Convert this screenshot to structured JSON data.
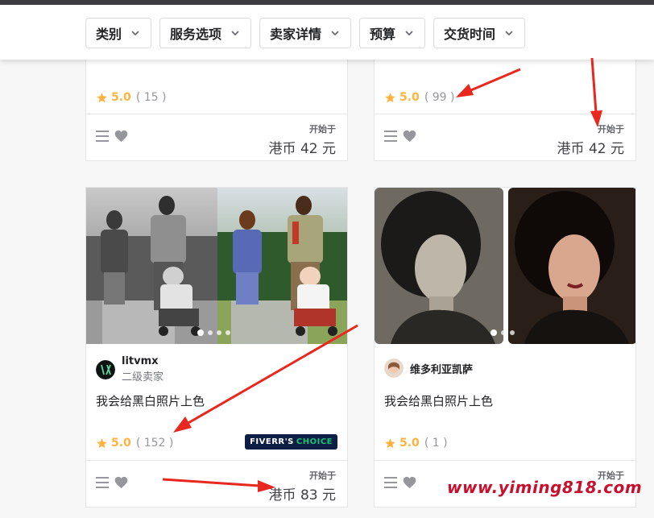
{
  "filters": [
    {
      "label": "类别"
    },
    {
      "label": "服务选项"
    },
    {
      "label": "卖家详情"
    },
    {
      "label": "预算"
    },
    {
      "label": "交货时间"
    }
  ],
  "top_cards": [
    {
      "rating": "5.0",
      "reviews": "( 15 )",
      "start_label": "开始于",
      "price": "港币 42 元"
    },
    {
      "rating": "5.0",
      "reviews": "( 99 )",
      "start_label": "开始于",
      "price": "港币 42 元"
    }
  ],
  "cards": [
    {
      "seller_name": "litvmx",
      "seller_level": "二级卖家",
      "title": "我会给黑白照片上色",
      "rating": "5.0",
      "reviews": "( 152 )",
      "badge_brand": "FIVERR'S",
      "badge_choice": "CHOICE",
      "start_label": "开始于",
      "price": "港币 83 元"
    },
    {
      "seller_name": "维多利亚凯萨",
      "seller_level": "",
      "title": "我会给黑白照片上色",
      "rating": "5.0",
      "reviews": "( 1 )",
      "start_label": "开始于",
      "price": ""
    }
  ],
  "watermark": "www.yiming818.com",
  "colors": {
    "star": "#ffb33e",
    "arrow": "#e8271e",
    "badge_bg": "#0e1e44",
    "badge_choice": "#1dbf73",
    "watermark": "#c8102e"
  },
  "icons": [
    "chevron-down-icon",
    "star-icon",
    "menu-icon",
    "heart-icon"
  ]
}
